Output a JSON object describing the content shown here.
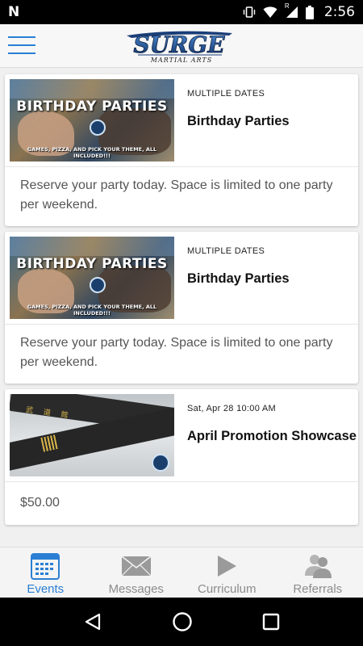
{
  "status_bar": {
    "carrier_icon": "n-notification-icon",
    "time": "2:56",
    "icons": [
      "vibrate-icon",
      "wifi-icon",
      "signal-icon",
      "battery-icon"
    ],
    "roaming_label": "R"
  },
  "header": {
    "menu_icon": "hamburger-menu-icon",
    "logo_text": "SURGE",
    "logo_subtext": "MARTIAL ARTS"
  },
  "events": [
    {
      "date": "MULTIPLE DATES",
      "title": "Birthday Parties",
      "description": "Reserve your party today. Space is limited to one party per weekend.",
      "image": {
        "headline": "BIRTHDAY PARTIES",
        "caption": "GAMES, PIZZA, AND PICK YOUR THEME, ALL INCLUDED!!!"
      }
    },
    {
      "date": "MULTIPLE DATES",
      "title": "Birthday Parties",
      "description": "Reserve your party today. Space is limited to one party per weekend.",
      "image": {
        "headline": "BIRTHDAY PARTIES",
        "caption": "GAMES, PIZZA, AND PICK YOUR THEME, ALL INCLUDED!!!"
      }
    },
    {
      "date": "Sat, Apr 28 10:00 AM",
      "title": "April Promotion Showcase",
      "description": "$50.00",
      "image": {
        "glyphs": "武 道 館"
      }
    }
  ],
  "bottom_nav": {
    "items": [
      {
        "label": "Events",
        "icon": "calendar-icon",
        "active": true
      },
      {
        "label": "Messages",
        "icon": "envelope-icon",
        "active": false
      },
      {
        "label": "Curriculum",
        "icon": "play-icon",
        "active": false
      },
      {
        "label": "Referrals",
        "icon": "people-icon",
        "active": false
      }
    ]
  },
  "system_nav": {
    "back_icon": "back-triangle-icon",
    "home_icon": "home-circle-icon",
    "recents_icon": "recents-square-icon"
  },
  "colors": {
    "accent": "#2a7fd4",
    "inactive": "#8c8c8c",
    "background": "#f0f0f0",
    "card": "#ffffff"
  }
}
